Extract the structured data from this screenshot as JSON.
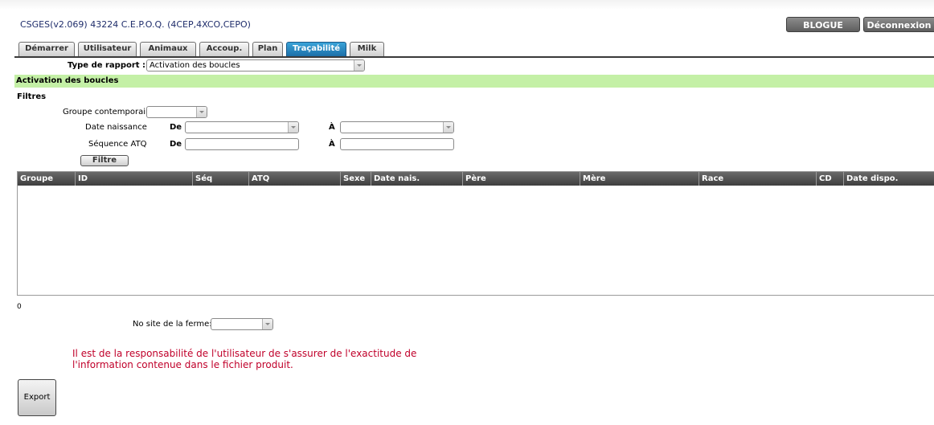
{
  "header": {
    "title": "CSGES(v2.069) 43224 C.E.P.O.Q. (4CEP,4XCO,CEPO)",
    "blog_button": "BLOGUE",
    "logout_button": "Déconnexion"
  },
  "tabs": [
    {
      "label": "Démarrer"
    },
    {
      "label": "Utilisateur"
    },
    {
      "label": "Animaux"
    },
    {
      "label": "Accoup."
    },
    {
      "label": "Plan"
    },
    {
      "label": "Traçabilité",
      "active": true
    },
    {
      "label": "Milk"
    }
  ],
  "report": {
    "type_label": "Type de rapport :",
    "type_value": "Activation des boucles"
  },
  "section_title": "Activation des boucles",
  "filters": {
    "title": "Filtres",
    "group_label": "Groupe contemporain",
    "birth_label": "Date naissance",
    "seq_label": "Séquence ATQ",
    "from_label": "De",
    "to_label": "À",
    "button": "Filtre"
  },
  "grid": {
    "columns": [
      "Groupe",
      "ID",
      "Séq",
      "ATQ",
      "Sexe",
      "Date nais.",
      "Père",
      "Mère",
      "Race",
      "CD",
      "Date dispo."
    ],
    "count": "0"
  },
  "farm": {
    "label": "No site de la ferme:"
  },
  "note": {
    "line1": "Il est de la responsabilité de l'utilisateur de s'assurer de l'exactitude de",
    "line2": "l'information contenue dans le fichier produit."
  },
  "export_button": "Export",
  "colors": {
    "section_bg": "#c4f0a6",
    "active_tab": "#2a8ac4",
    "note_text": "#c0002a",
    "title_text": "#1f2d6b"
  }
}
